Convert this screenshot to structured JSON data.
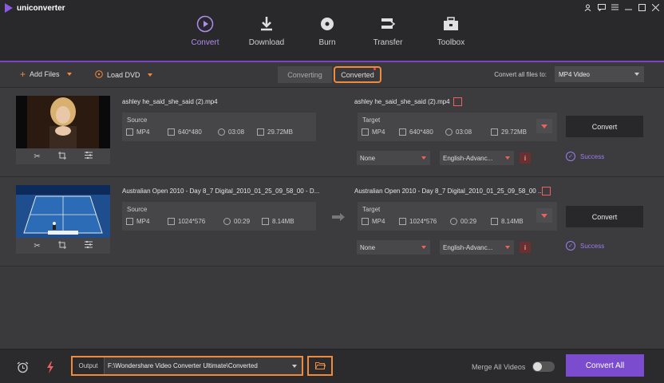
{
  "app": {
    "title": "uniconverter"
  },
  "nav": {
    "tabs": [
      {
        "label": "Convert",
        "icon": "convert-icon",
        "active": true
      },
      {
        "label": "Download",
        "icon": "download-icon",
        "active": false
      },
      {
        "label": "Burn",
        "icon": "burn-icon",
        "active": false
      },
      {
        "label": "Transfer",
        "icon": "transfer-icon",
        "active": false
      },
      {
        "label": "Toolbox",
        "icon": "toolbox-icon",
        "active": false
      }
    ]
  },
  "toolbar": {
    "add_files": "Add Files",
    "load_dvd": "Load DVD",
    "converting_tab": "Converting",
    "converted_tab": "Converted",
    "convert_all_label": "Convert all files to:",
    "format": "MP4 Video"
  },
  "files": [
    {
      "name": "ashley he_said_she_said (2).mp4",
      "source": {
        "label": "Source",
        "format": "MP4",
        "resolution": "640*480",
        "duration": "03:08",
        "size": "29.72MB"
      },
      "target": {
        "name": "ashley he_said_she_said (2).mp4",
        "label": "Target",
        "format": "MP4",
        "resolution": "640*480",
        "duration": "03:08",
        "size": "29.72MB"
      },
      "subtitle": "None",
      "audio": "English-Advanc...",
      "convert_label": "Convert",
      "status": "Success"
    },
    {
      "name": "Australian Open 2010 - Day 8_7 Digital_2010_01_25_09_58_00 - D...",
      "source": {
        "label": "Source",
        "format": "MP4",
        "resolution": "1024*576",
        "duration": "00:29",
        "size": "8.14MB"
      },
      "target": {
        "name": "Australian Open 2010 - Day 8_7 Digital_2010_01_25_09_58_00 ...",
        "label": "Target",
        "format": "MP4",
        "resolution": "1024*576",
        "duration": "00:29",
        "size": "8.14MB"
      },
      "subtitle": "None",
      "audio": "English-Advanc...",
      "convert_label": "Convert",
      "status": "Success"
    }
  ],
  "bottom": {
    "output_label": "Output",
    "output_path": "F:\\Wondershare Video Converter Ultimate\\Converted",
    "merge_label": "Merge All Videos",
    "merge_on": false,
    "convert_all": "Convert All"
  },
  "colors": {
    "accent": "#7b4ccd",
    "highlight": "#f08a3c",
    "danger": "#f06060"
  }
}
